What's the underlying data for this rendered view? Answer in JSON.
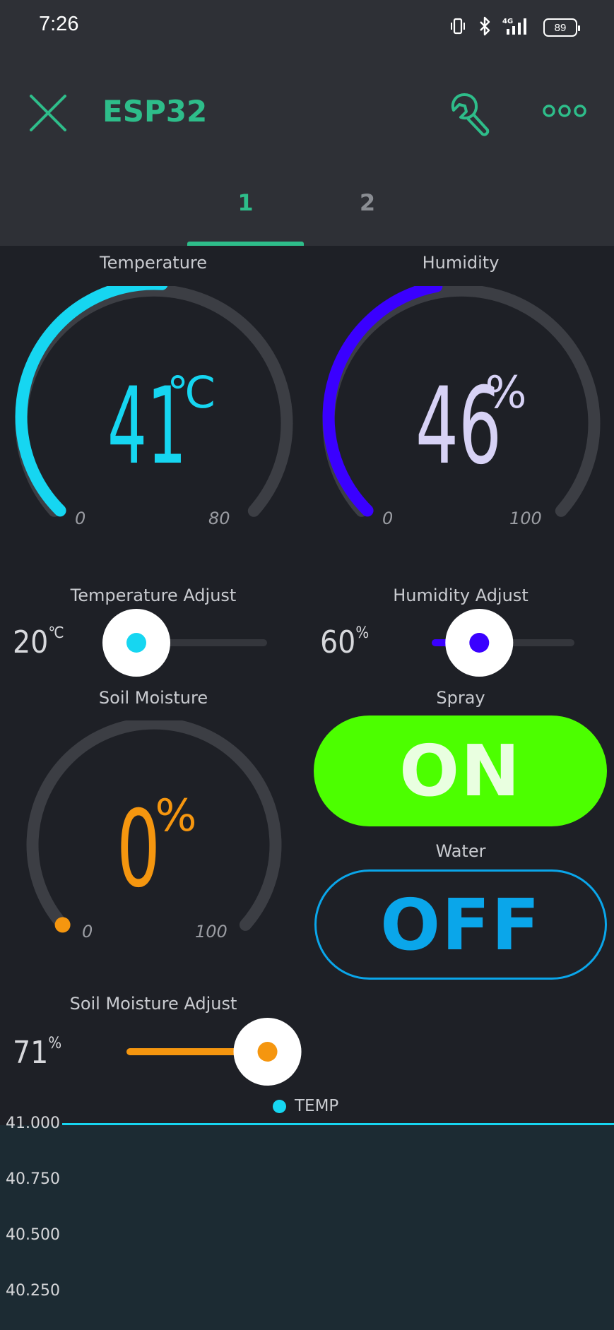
{
  "status_bar": {
    "time": "7:26",
    "battery": "89",
    "network": "4G",
    "icons": [
      "vibrate-icon",
      "bluetooth-icon",
      "signal-4g-icon",
      "battery-icon"
    ]
  },
  "app_bar": {
    "title": "ESP32",
    "close_icon": "close-icon",
    "settings_icon": "wrench-icon",
    "more_icon": "more-dots-icon",
    "accent": "#2ebd8a"
  },
  "tabs": [
    {
      "label": "1",
      "active": true
    },
    {
      "label": "2",
      "active": false
    }
  ],
  "widgets": {
    "temperature": {
      "label": "Temperature",
      "value": "41",
      "unit": "℃",
      "min": "0",
      "max": "80",
      "color": "#16d6f1",
      "level": 41,
      "range": [
        0,
        80
      ]
    },
    "humidity": {
      "label": "Humidity",
      "value": "46",
      "unit": "%",
      "min": "0",
      "max": "100",
      "color": "#3a00ff",
      "value_color": "#d7d2f5",
      "level": 46,
      "range": [
        0,
        100
      ]
    },
    "temperature_adjust": {
      "label": "Temperature Adjust",
      "value": "20",
      "unit": "℃",
      "color": "#16d6f1",
      "fraction": 0.0
    },
    "humidity_adjust": {
      "label": "Humidity Adjust",
      "value": "60",
      "unit": "%",
      "color": "#3a00ff",
      "fraction": 0.35
    },
    "soil_moisture": {
      "label": "Soil Moisture",
      "value": "0",
      "unit": "%",
      "min": "0",
      "max": "100",
      "color": "#f5960f",
      "level": 0,
      "range": [
        0,
        100
      ]
    },
    "spray": {
      "label": "Spray",
      "state": "ON",
      "color": "#4cff00"
    },
    "water": {
      "label": "Water",
      "state": "OFF",
      "color": "#0aa6ea"
    },
    "soil_moisture_adjust": {
      "label": "Soil Moisture Adjust",
      "value": "71",
      "unit": "%",
      "color": "#f5960f",
      "fraction": 0.71
    }
  },
  "chart_data": {
    "type": "line",
    "series": [
      {
        "name": "TEMP",
        "color": "#16d6f1",
        "values": [
          41.0
        ]
      }
    ],
    "y_ticks": [
      "41.000",
      "40.750",
      "40.500",
      "40.250"
    ],
    "ylim": [
      40.25,
      41.0
    ]
  }
}
